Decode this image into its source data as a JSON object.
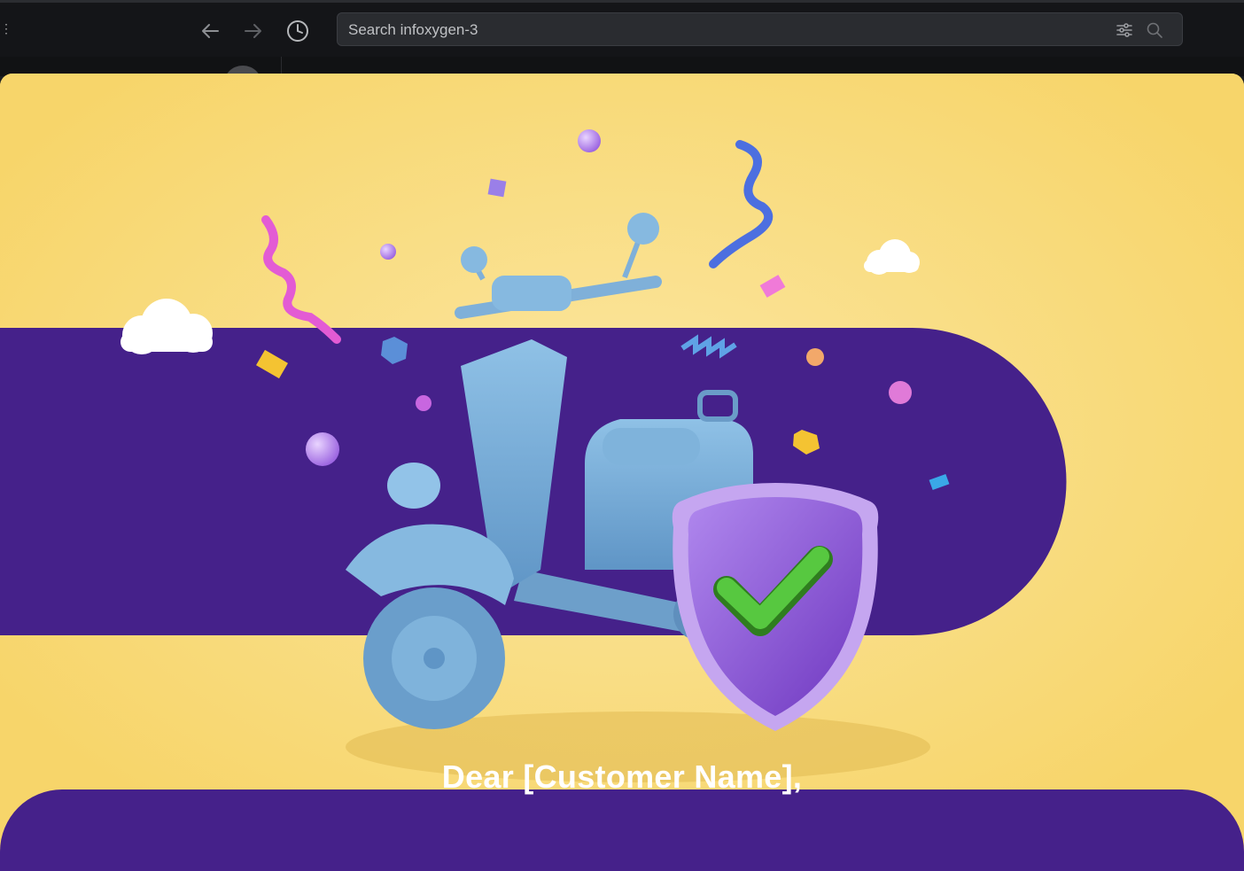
{
  "toolbar": {
    "back_icon": "arrow-left-icon",
    "forward_icon": "arrow-right-icon",
    "history_icon": "clock-icon",
    "search_placeholder": "Search infoxygen-3",
    "filter_icon": "sliders-icon",
    "search_icon": "magnifier-icon"
  },
  "email": {
    "greeting": "Dear [Customer Name],",
    "hero_illustration": "scooter-with-shield-check-icon",
    "colors": {
      "background_yellow": "#f8d76c",
      "band_purple": "#45218a",
      "scooter_blue": "#7cb2da",
      "shield_purple": "#8e5bd3",
      "check_green": "#4cc23a"
    }
  }
}
